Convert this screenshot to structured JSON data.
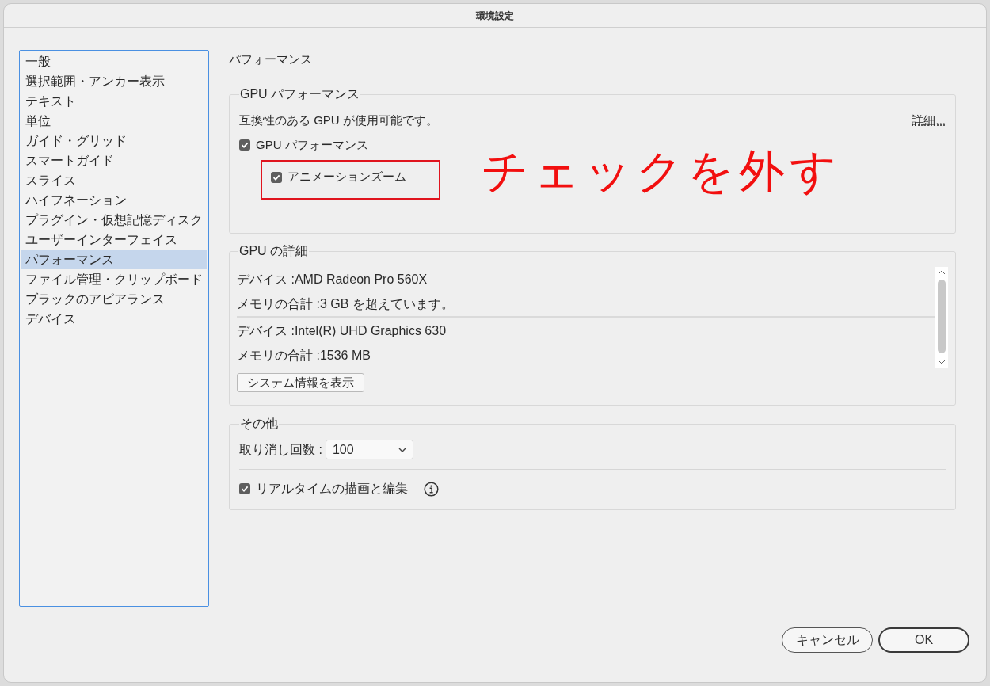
{
  "window": {
    "title": "環境設定"
  },
  "sidebar": {
    "items": [
      {
        "label": "一般",
        "selected": false
      },
      {
        "label": "選択範囲・アンカー表示",
        "selected": false
      },
      {
        "label": "テキスト",
        "selected": false
      },
      {
        "label": "単位",
        "selected": false
      },
      {
        "label": "ガイド・グリッド",
        "selected": false
      },
      {
        "label": "スマートガイド",
        "selected": false
      },
      {
        "label": "スライス",
        "selected": false
      },
      {
        "label": "ハイフネーション",
        "selected": false
      },
      {
        "label": "プラグイン・仮想記憶ディスク",
        "selected": false
      },
      {
        "label": "ユーザーインターフェイス",
        "selected": false
      },
      {
        "label": "パフォーマンス",
        "selected": true
      },
      {
        "label": "ファイル管理・クリップボード",
        "selected": false
      },
      {
        "label": "ブラックのアピアランス",
        "selected": false
      },
      {
        "label": "デバイス",
        "selected": false
      }
    ]
  },
  "section_title": "パフォーマンス",
  "gpu_performance": {
    "legend": "GPU パフォーマンス",
    "status": "互換性のある GPU が使用可能です。",
    "details_link": "詳細...",
    "checkbox": {
      "label": "GPU パフォーマンス",
      "checked": true
    },
    "sub_checkbox": {
      "label": "アニメーションズーム",
      "checked": true
    }
  },
  "annotation": {
    "text": "チェックを外す"
  },
  "gpu_details": {
    "legend": "GPU の詳細",
    "devices": [
      {
        "device": "デバイス :AMD Radeon Pro 560X",
        "memory": "メモリの合計 :3 GB を超えています。"
      },
      {
        "device": "デバイス :Intel(R) UHD Graphics 630",
        "memory": "メモリの合計 :1536 MB"
      }
    ],
    "button": "システム情報を表示"
  },
  "other": {
    "legend": "その他",
    "undo_label": "取り消し回数 :",
    "undo_value": "100",
    "realtime": {
      "label": "リアルタイムの描画と編集",
      "checked": true
    }
  },
  "buttons": [
    {
      "label": "キャンセル",
      "kind": "secondary"
    },
    {
      "label": "OK",
      "kind": "default"
    }
  ]
}
